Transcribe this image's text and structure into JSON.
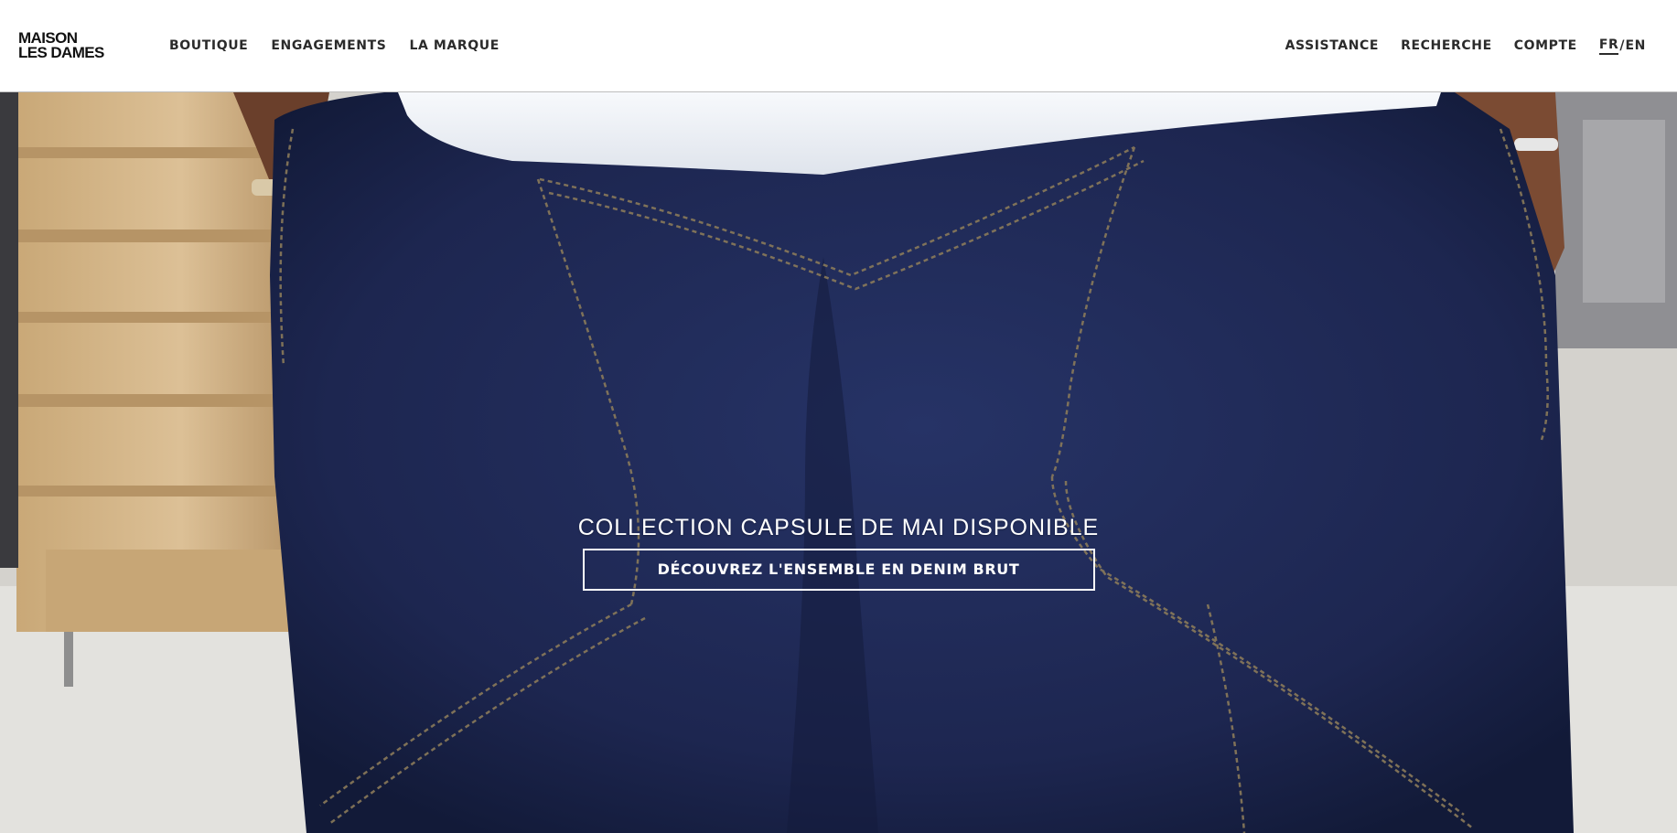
{
  "brand": {
    "line1": "MAISON",
    "line2": "LES DAMES"
  },
  "nav_left": [
    {
      "label": "BOUTIQUE"
    },
    {
      "label": "ENGAGEMENTS"
    },
    {
      "label": "LA MARQUE"
    }
  ],
  "nav_right": [
    {
      "label": "ASSISTANCE"
    },
    {
      "label": "RECHERCHE"
    },
    {
      "label": "COMPTE"
    }
  ],
  "language": {
    "active": "FR",
    "separator": "/",
    "other": "EN"
  },
  "hero": {
    "title": "COLLECTION CAPSULE DE MAI DISPONIBLE",
    "cta_label": "DÉCOUVREZ L'ENSEMBLE EN DENIM BRUT"
  },
  "colors": {
    "denim": "#1f2a55",
    "denim_dark": "#131b3a",
    "stitch": "#8a7a5a",
    "wood": "#d6b887",
    "shirt": "#f1f4f8",
    "skin": "#7a4a32"
  }
}
